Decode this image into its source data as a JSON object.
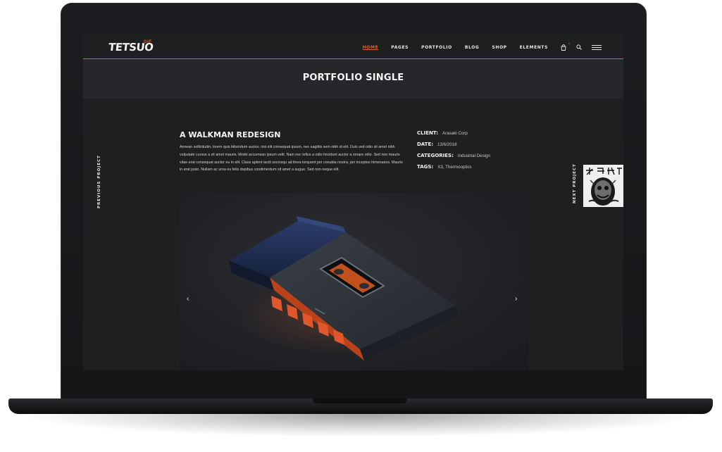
{
  "header": {
    "logo": "TETSUO",
    "logo_sup": "GIF",
    "nav": [
      {
        "label": "HOME",
        "active": true
      },
      {
        "label": "PAGES"
      },
      {
        "label": "PORTFOLIO"
      },
      {
        "label": "BLOG"
      },
      {
        "label": "SHOP"
      },
      {
        "label": "ELEMENTS"
      }
    ],
    "cart_count": "0",
    "icons": [
      "cart-icon",
      "search-icon",
      "menu-icon"
    ]
  },
  "page": {
    "title": "PORTFOLIO SINGLE"
  },
  "side_nav": {
    "previous": "PREVIOUS PROJECT",
    "next": "NEXT PROJECT"
  },
  "project": {
    "title": "A WALKMAN REDESIGN",
    "description": "Aenean sollicitudin, lorem quis bibendum auctor, nisi elit consequat ipsum, nec sagittis sem nibh id elit. Duis sed odio sit amet nibh vulputate cursus a sit amet mauris. Morbi accumsan ipsum velit. Nam nec tellus a odio tincidunt auctor a ornare odio. Sed non  mauris vitae erat consequat auctor eu in elit. Class aptent taciti sociosqu ad litora torquent per conubia nostra, per inceptos himenaeos. Mauris in erat justo. Nullam ac urna eu felis dapibus condimentum sit amet a augue. Sed non neque elit.",
    "meta": [
      {
        "label": "CLIENT:",
        "value": "Arasaki Corp"
      },
      {
        "label": "DATE:",
        "value": "13/6/2018"
      },
      {
        "label": "CATEGORIES:",
        "value": "Industrial Design"
      },
      {
        "label": "TAGS:",
        "value": "X3, Thermooptics"
      }
    ]
  },
  "gallery": {
    "prev_arrow": "‹",
    "next_arrow": "›"
  },
  "colors": {
    "accent": "#e0622b",
    "background": "#1e1f21",
    "band": "#26272a"
  }
}
